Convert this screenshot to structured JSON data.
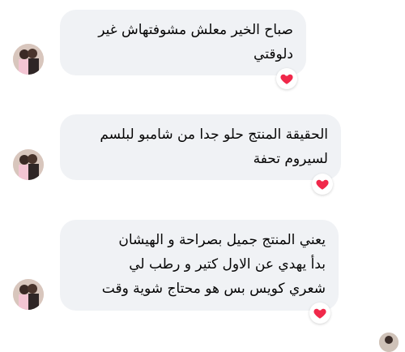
{
  "messages": [
    {
      "lines": [
        "صباح الخير معلش مشوفتهاش غير",
        "دلوقتي"
      ],
      "reaction": "heart-icon"
    },
    {
      "lines": [
        "الحقيقة المنتج حلو جدا من شامبو لبلسم",
        "لسيروم تحفة"
      ],
      "reaction": "heart-icon"
    },
    {
      "lines": [
        "يعني المنتج جميل بصراحة و الهيشان",
        "بدأ يهدي عن الاول كتير و رطب لي",
        "شعري كويس بس هو محتاج شوية وقت"
      ],
      "reaction": "heart-icon"
    }
  ],
  "colors": {
    "bubble": "#f0f2f5",
    "text": "#050505",
    "heart": "#f0284a"
  }
}
